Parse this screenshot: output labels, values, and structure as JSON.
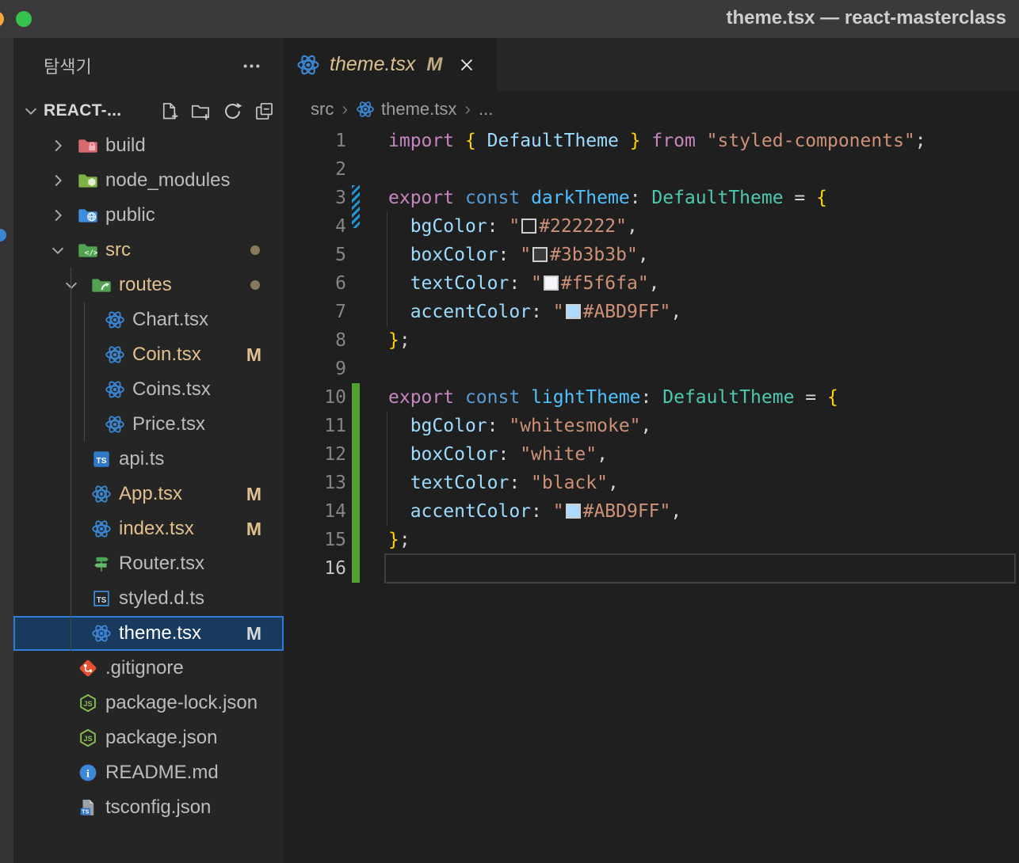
{
  "window": {
    "title": "theme.tsx — react-masterclass",
    "traffic_lights": [
      "orange",
      "green"
    ]
  },
  "explorer": {
    "title": "탐색기",
    "section_label": "REACT-...",
    "actions": [
      "new-file",
      "new-folder",
      "refresh",
      "collapse-all"
    ],
    "tree": [
      {
        "label": "build",
        "depth": 0,
        "type": "folder",
        "icon": "folder-build",
        "chevron": "right"
      },
      {
        "label": "node_modules",
        "depth": 0,
        "type": "folder",
        "icon": "folder-node",
        "chevron": "right"
      },
      {
        "label": "public",
        "depth": 0,
        "type": "folder",
        "icon": "folder-public",
        "chevron": "right"
      },
      {
        "label": "src",
        "depth": 0,
        "type": "folder",
        "icon": "folder-src",
        "chevron": "down",
        "modified": true,
        "badge": "dot"
      },
      {
        "label": "routes",
        "depth": 1,
        "type": "folder",
        "icon": "folder-routes",
        "chevron": "down",
        "modified": true,
        "badge": "dot"
      },
      {
        "label": "Chart.tsx",
        "depth": 2,
        "type": "file",
        "icon": "react"
      },
      {
        "label": "Coin.tsx",
        "depth": 2,
        "type": "file",
        "icon": "react",
        "modified": true,
        "badge": "M"
      },
      {
        "label": "Coins.tsx",
        "depth": 2,
        "type": "file",
        "icon": "react"
      },
      {
        "label": "Price.tsx",
        "depth": 2,
        "type": "file",
        "icon": "react"
      },
      {
        "label": "api.ts",
        "depth": 1,
        "type": "file",
        "icon": "ts"
      },
      {
        "label": "App.tsx",
        "depth": 1,
        "type": "file",
        "icon": "react",
        "modified": true,
        "badge": "M"
      },
      {
        "label": "index.tsx",
        "depth": 1,
        "type": "file",
        "icon": "react",
        "modified": true,
        "badge": "M"
      },
      {
        "label": "Router.tsx",
        "depth": 1,
        "type": "file",
        "icon": "router"
      },
      {
        "label": "styled.d.ts",
        "depth": 1,
        "type": "file",
        "icon": "ts-def"
      },
      {
        "label": "theme.tsx",
        "depth": 1,
        "type": "file",
        "icon": "react",
        "modified": true,
        "badge": "M",
        "selected": true
      },
      {
        "label": ".gitignore",
        "depth": 0,
        "type": "file",
        "icon": "git"
      },
      {
        "label": "package-lock.json",
        "depth": 0,
        "type": "file",
        "icon": "node"
      },
      {
        "label": "package.json",
        "depth": 0,
        "type": "file",
        "icon": "node"
      },
      {
        "label": "README.md",
        "depth": 0,
        "type": "file",
        "icon": "readme"
      },
      {
        "label": "tsconfig.json",
        "depth": 0,
        "type": "file",
        "icon": "tsconfig"
      }
    ]
  },
  "tab": {
    "file": "theme.tsx",
    "badge": "M",
    "icon": "react"
  },
  "breadcrumb": {
    "items": [
      {
        "label": "src"
      },
      {
        "label": "theme.tsx",
        "icon": "react"
      },
      {
        "label": "..."
      }
    ]
  },
  "editor": {
    "active_line": 16,
    "indent_guides": [
      {
        "from_line": 4,
        "to_line": 7
      },
      {
        "from_line": 11,
        "to_line": 14
      }
    ],
    "lines": [
      {
        "n": 1,
        "d": null,
        "tokens": [
          {
            "t": "import",
            "c": "kw"
          },
          {
            "t": " ",
            "c": "pu"
          },
          {
            "t": "{",
            "c": "br"
          },
          {
            "t": " ",
            "c": "pu"
          },
          {
            "t": "DefaultTheme",
            "c": "pr"
          },
          {
            "t": " ",
            "c": "pu"
          },
          {
            "t": "}",
            "c": "br"
          },
          {
            "t": " ",
            "c": "pu"
          },
          {
            "t": "from",
            "c": "kw"
          },
          {
            "t": " ",
            "c": "pu"
          },
          {
            "t": "\"styled-components\"",
            "c": "st"
          },
          {
            "t": ";",
            "c": "pu"
          }
        ]
      },
      {
        "n": 2,
        "d": null,
        "tokens": []
      },
      {
        "n": 3,
        "d": "modified",
        "tokens": [
          {
            "t": "export",
            "c": "kw"
          },
          {
            "t": " ",
            "c": "pu"
          },
          {
            "t": "const",
            "c": "cb"
          },
          {
            "t": " ",
            "c": "pu"
          },
          {
            "t": "darkTheme",
            "c": "va"
          },
          {
            "t": ": ",
            "c": "pu"
          },
          {
            "t": "DefaultTheme",
            "c": "ty"
          },
          {
            "t": " = ",
            "c": "pu"
          },
          {
            "t": "{",
            "c": "br"
          }
        ]
      },
      {
        "n": 4,
        "d": null,
        "tokens": [
          {
            "t": "  ",
            "c": "pu"
          },
          {
            "t": "bgColor",
            "c": "pr"
          },
          {
            "t": ": ",
            "c": "pu"
          },
          {
            "t": "\"",
            "c": "st"
          },
          {
            "sw": "#222222"
          },
          {
            "t": "#222222\"",
            "c": "st"
          },
          {
            "t": ",",
            "c": "pu"
          }
        ]
      },
      {
        "n": 5,
        "d": null,
        "tokens": [
          {
            "t": "  ",
            "c": "pu"
          },
          {
            "t": "boxColor",
            "c": "pr"
          },
          {
            "t": ": ",
            "c": "pu"
          },
          {
            "t": "\"",
            "c": "st"
          },
          {
            "sw": "#3b3b3b"
          },
          {
            "t": "#3b3b3b\"",
            "c": "st"
          },
          {
            "t": ",",
            "c": "pu"
          }
        ]
      },
      {
        "n": 6,
        "d": null,
        "tokens": [
          {
            "t": "  ",
            "c": "pu"
          },
          {
            "t": "textColor",
            "c": "pr"
          },
          {
            "t": ": ",
            "c": "pu"
          },
          {
            "t": "\"",
            "c": "st"
          },
          {
            "sw": "#f5f6fa"
          },
          {
            "t": "#f5f6fa\"",
            "c": "st"
          },
          {
            "t": ",",
            "c": "pu"
          }
        ]
      },
      {
        "n": 7,
        "d": null,
        "tokens": [
          {
            "t": "  ",
            "c": "pu"
          },
          {
            "t": "accentColor",
            "c": "pr"
          },
          {
            "t": ": ",
            "c": "pu"
          },
          {
            "t": "\"",
            "c": "st"
          },
          {
            "sw": "#ABD9FF"
          },
          {
            "t": "#ABD9FF\"",
            "c": "st"
          },
          {
            "t": ",",
            "c": "pu"
          }
        ]
      },
      {
        "n": 8,
        "d": null,
        "tokens": [
          {
            "t": "}",
            "c": "br"
          },
          {
            "t": ";",
            "c": "pu"
          }
        ]
      },
      {
        "n": 9,
        "d": null,
        "tokens": []
      },
      {
        "n": 10,
        "d": "added",
        "tokens": [
          {
            "t": "export",
            "c": "kw"
          },
          {
            "t": " ",
            "c": "pu"
          },
          {
            "t": "const",
            "c": "cb"
          },
          {
            "t": " ",
            "c": "pu"
          },
          {
            "t": "lightTheme",
            "c": "va"
          },
          {
            "t": ": ",
            "c": "pu"
          },
          {
            "t": "DefaultTheme",
            "c": "ty"
          },
          {
            "t": " = ",
            "c": "pu"
          },
          {
            "t": "{",
            "c": "br"
          }
        ]
      },
      {
        "n": 11,
        "d": "added",
        "tokens": [
          {
            "t": "  ",
            "c": "pu"
          },
          {
            "t": "bgColor",
            "c": "pr"
          },
          {
            "t": ": ",
            "c": "pu"
          },
          {
            "t": "\"whitesmoke\"",
            "c": "st"
          },
          {
            "t": ",",
            "c": "pu"
          }
        ]
      },
      {
        "n": 12,
        "d": "added",
        "tokens": [
          {
            "t": "  ",
            "c": "pu"
          },
          {
            "t": "boxColor",
            "c": "pr"
          },
          {
            "t": ": ",
            "c": "pu"
          },
          {
            "t": "\"white\"",
            "c": "st"
          },
          {
            "t": ",",
            "c": "pu"
          }
        ]
      },
      {
        "n": 13,
        "d": "added",
        "tokens": [
          {
            "t": "  ",
            "c": "pu"
          },
          {
            "t": "textColor",
            "c": "pr"
          },
          {
            "t": ": ",
            "c": "pu"
          },
          {
            "t": "\"black\"",
            "c": "st"
          },
          {
            "t": ",",
            "c": "pu"
          }
        ]
      },
      {
        "n": 14,
        "d": "added",
        "tokens": [
          {
            "t": "  ",
            "c": "pu"
          },
          {
            "t": "accentColor",
            "c": "pr"
          },
          {
            "t": ": ",
            "c": "pu"
          },
          {
            "t": "\"",
            "c": "st"
          },
          {
            "sw": "#ABD9FF"
          },
          {
            "t": "#ABD9FF\"",
            "c": "st"
          },
          {
            "t": ",",
            "c": "pu"
          }
        ]
      },
      {
        "n": 15,
        "d": "added",
        "tokens": [
          {
            "t": "}",
            "c": "br"
          },
          {
            "t": ";",
            "c": "pu"
          }
        ]
      },
      {
        "n": 16,
        "d": "added",
        "tokens": []
      }
    ]
  },
  "colors": {
    "modified_tan": "#E2C08D",
    "selection_bg": "#173A5E",
    "selection_border": "#2D7CD5",
    "added_gutter_green": "#52A032",
    "modified_gutter_blue": "#2098D8",
    "react_icon_blue": "#3A86D2",
    "string_orange": "#CE9178",
    "keyword_purple": "#C586C0",
    "type_teal": "#4EC9B0",
    "property_blue": "#9CDCFE",
    "swatches": [
      "#222222",
      "#3b3b3b",
      "#f5f6fa",
      "#ABD9FF"
    ]
  }
}
